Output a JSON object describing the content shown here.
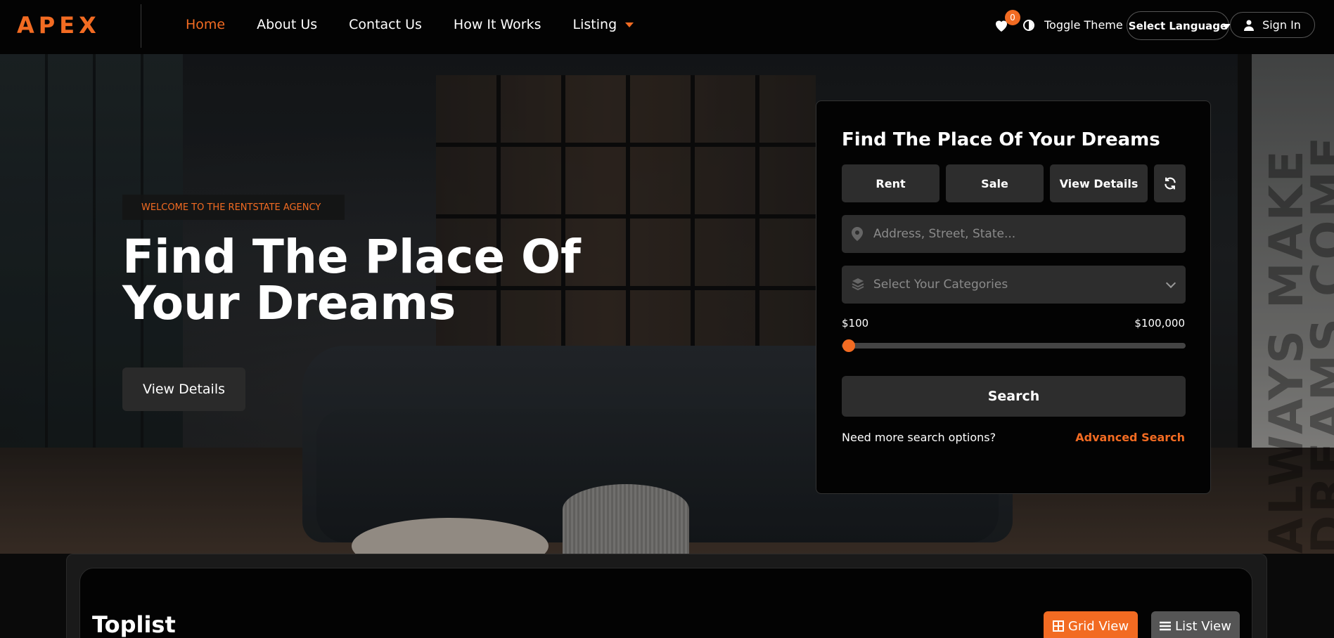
{
  "header": {
    "logo": "APEX",
    "nav": [
      {
        "label": "Home",
        "active": true
      },
      {
        "label": "About Us",
        "active": false
      },
      {
        "label": "Contact Us",
        "active": false
      },
      {
        "label": "How It Works",
        "active": false
      },
      {
        "label": "Listing",
        "active": false
      }
    ],
    "wishlist_count": "0",
    "theme_label": "Toggle Theme",
    "language_label": "Select Language",
    "signin_label": "Sign In"
  },
  "hero": {
    "eyebrow": "WELCOME TO THE RENTSTATE AGENCY",
    "title": "Find The Place Of Your Dreams",
    "cta_label": "View Details",
    "watermark": "ALWAYS MAKE DREAMS COME"
  },
  "search_panel": {
    "title": "Find The Place Of Your Dreams",
    "tabs": [
      "Rent",
      "Sale",
      "View Details"
    ],
    "address_placeholder": "Address, Street, State...",
    "category_placeholder": "Select Your Categories",
    "price_min_label": "$100",
    "price_max_label": "$100,000",
    "price_range_fraction": 0.0,
    "search_label": "Search",
    "more_options_text": "Need more search options?",
    "advanced_label": "Advanced Search"
  },
  "toplist": {
    "title": "Toplist",
    "grid_label": "Grid View",
    "list_label": "List View"
  },
  "colors": {
    "accent": "#f26b22",
    "background": "#030303",
    "panel": "#2d2d2d"
  }
}
